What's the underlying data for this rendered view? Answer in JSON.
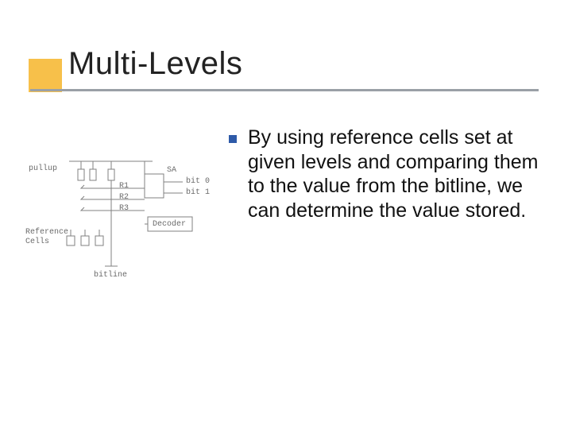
{
  "title": "Multi-Levels",
  "bullets": [
    "By using reference cells set at given levels and comparing them to the value from the bitline, we can determine the value stored."
  ],
  "diagram": {
    "labels": {
      "pullup": "pullup",
      "r1": "R1",
      "r2": "R2",
      "r3": "R3",
      "sa": "SA",
      "bit0": "bit 0",
      "bit1": "bit 1",
      "decoder": "Decoder",
      "reference_cells_l1": "Reference",
      "reference_cells_l2": "Cells",
      "bitline": "bitline"
    }
  }
}
